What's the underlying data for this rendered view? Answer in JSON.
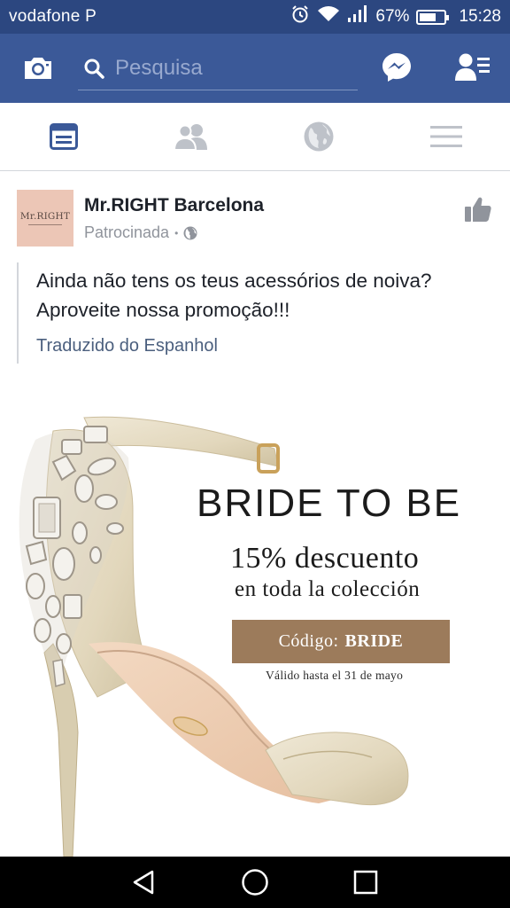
{
  "status_bar": {
    "carrier": "vodafone P",
    "battery_percent": "67%",
    "battery_level": 0.67,
    "time": "15:28",
    "icons": [
      "alarm-icon",
      "wifi-icon",
      "signal-icon",
      "battery-icon"
    ]
  },
  "header": {
    "search_placeholder": "Pesquisa",
    "icons": [
      "camera-icon",
      "search-icon",
      "messenger-icon",
      "friend-requests-icon"
    ],
    "background": "#3b5998"
  },
  "tabs": [
    {
      "name": "news-feed",
      "icon": "news-feed-icon",
      "active": true
    },
    {
      "name": "friends",
      "icon": "friends-icon",
      "active": false
    },
    {
      "name": "notifications",
      "icon": "globe-icon",
      "active": false
    },
    {
      "name": "menu",
      "icon": "menu-icon",
      "active": false
    }
  ],
  "post": {
    "page_name": "Mr.RIGHT Barcelona",
    "avatar_text": "Mr.RIGHT",
    "sponsored_label": "Patrocinada",
    "separator": "•",
    "text": "Ainda não tens os teus acessórios de noiva? Aproveite nossa promoção!!!",
    "translated_label": "Traduzido do Espanhol"
  },
  "ad": {
    "headline": "BRIDE TO BE",
    "discount": "15% descuento",
    "subtitle": "en toda la colección",
    "code_label": "Código:",
    "code_value": "BRIDE",
    "validity": "Válido hasta el 31 de mayo",
    "accent": "#9c7b5b"
  },
  "navigation": {
    "icons": [
      "back-icon",
      "home-icon",
      "recents-icon"
    ]
  }
}
